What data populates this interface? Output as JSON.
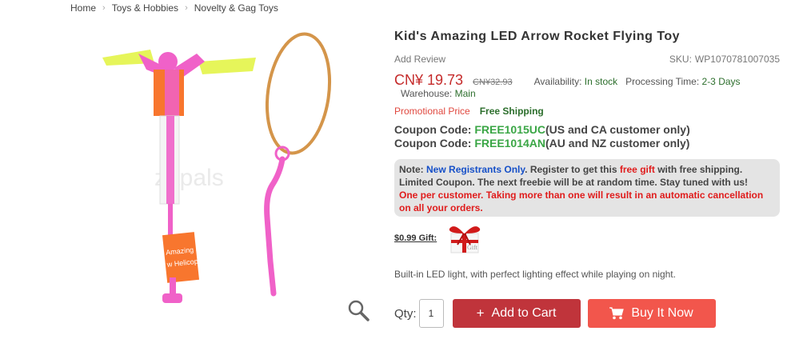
{
  "breadcrumb": [
    "Home",
    "Toys & Hobbies",
    "Novelty & Gag Toys"
  ],
  "product": {
    "title": "Kid's Amazing LED Arrow Rocket Flying Toy",
    "add_review": "Add Review",
    "sku_label": "SKU:",
    "sku": "WP1070781007035",
    "price": "CN¥ 19.73",
    "old_price": "CN¥32.93",
    "availability_label": "Availability:",
    "availability": "In stock",
    "processing_label": "Processing Time:",
    "processing": "2-3 Days",
    "warehouse_label": "Warehouse:",
    "warehouse": "Main",
    "promo_price": "Promotional Price",
    "free_shipping": "Free Shipping",
    "description": "Built-in LED light, with perfect lighting effect while playing on night.",
    "image_watermark": "zapals",
    "image_label_text": "Amazing S",
    "image_label_text2": "w Helicopt"
  },
  "coupons": [
    {
      "label": "Coupon Code:",
      "code": "FREE1015UC",
      "note": "(US and CA customer only)"
    },
    {
      "label": "Coupon Code:",
      "code": "FREE1014AN",
      "note": "(AU and NZ customer only)"
    }
  ],
  "note": {
    "prefix": "Note:",
    "blue": "New Registrants Only",
    "part1": ". Register to get this ",
    "red": "free gift",
    "part2": " with free shipping. Limited Coupon. The next freebie will be at random time. Stay tuned with us!",
    "warning": "One per customer. Taking more than one will result in an automatic cancellation on all your orders."
  },
  "gift": {
    "label": "$0.99 Gift:",
    "tag": "Gift"
  },
  "purchase": {
    "qty_label": "Qty:",
    "qty_value": "1",
    "add_to_cart": "Add to Cart",
    "buy_now": "Buy It Now"
  },
  "colors": {
    "price_red": "#c52b2b",
    "green": "#3aa645",
    "add_cart_bg": "#c0343b",
    "buy_now_bg": "#f2564c"
  },
  "icons": {
    "add_cart": "plus-icon",
    "buy_now": "cart-icon",
    "zoom": "magnifier-icon"
  }
}
